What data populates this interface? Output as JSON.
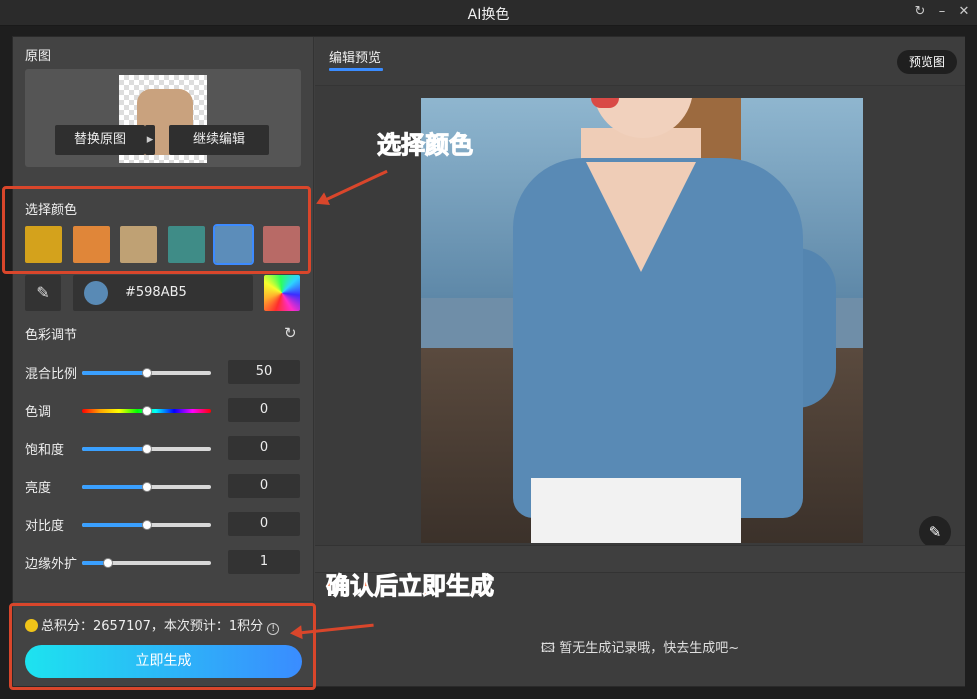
{
  "window": {
    "title": "AI换色"
  },
  "left": {
    "original": {
      "label": "原图",
      "replace_button": "替换原图",
      "continue_button": "继续编辑"
    },
    "colors": {
      "label": "选择颜色",
      "swatches": [
        "#D4A21C",
        "#E08639",
        "#BFA174",
        "#3F8C87",
        "#5C8DBA",
        "#B86A66"
      ],
      "selected_index": 4,
      "hex_value": "#598AB5"
    },
    "adjust": {
      "label": "色彩调节",
      "sliders": [
        {
          "label": "混合比例",
          "value": "50",
          "fraction": 0.5,
          "type": "normal"
        },
        {
          "label": "色调",
          "value": "0",
          "fraction": 0.5,
          "type": "hue"
        },
        {
          "label": "饱和度",
          "value": "0",
          "fraction": 0.5,
          "type": "normal"
        },
        {
          "label": "亮度",
          "value": "0",
          "fraction": 0.5,
          "type": "normal"
        },
        {
          "label": "对比度",
          "value": "0",
          "fraction": 0.5,
          "type": "normal"
        },
        {
          "label": "边缘外扩",
          "value": "1",
          "fraction": 0.2,
          "type": "normal"
        }
      ]
    },
    "footer": {
      "points_text": "总积分：2657107，本次预计：1积分",
      "generate_button": "立即生成"
    }
  },
  "right": {
    "tab": "编辑预览",
    "preview_button": "预览图",
    "empty_history": "暂无生成记录哦，快去生成吧~"
  },
  "annotations": {
    "select_color": "选择颜色",
    "confirm_generate": "确认后立即生成"
  },
  "icons": {
    "refresh": "refresh-icon",
    "eyedropper": "eyedropper-icon",
    "edit": "edit-icon",
    "info": "info-icon",
    "coin": "coin-icon",
    "image": "image-icon"
  }
}
